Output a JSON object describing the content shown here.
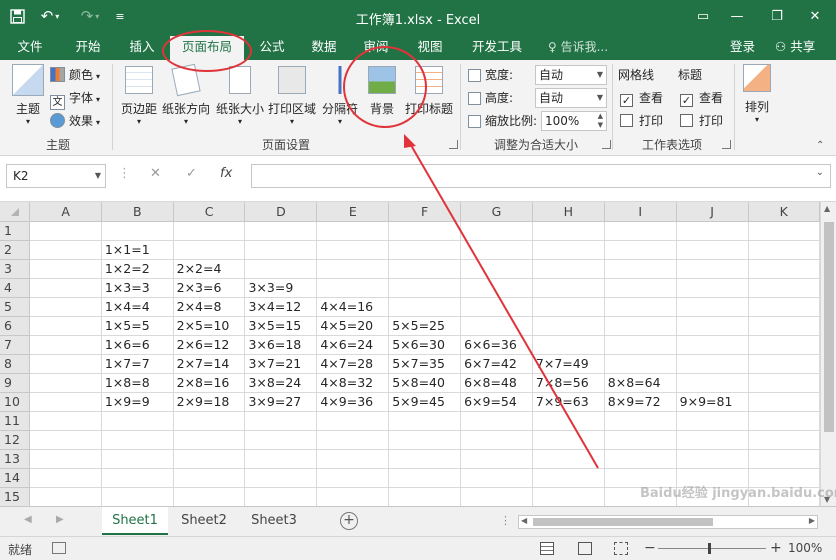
{
  "titlebar": {
    "save_icon": "save-icon",
    "undo_icon": "undo-icon",
    "redo_icon": "redo-icon",
    "title": "工作簿1.xlsx - Excel",
    "min": "—",
    "restore": "❐",
    "close": "✕",
    "ribbon_display": "▭"
  },
  "tabs": [
    "文件",
    "开始",
    "插入",
    "页面布局",
    "公式",
    "数据",
    "审阅",
    "视图",
    "开发工具"
  ],
  "active_tab": "页面布局",
  "tellme": "告诉我...",
  "login": "登录",
  "share": "共享",
  "ribbon": {
    "theme_group": {
      "label": "主题",
      "theme": "主题",
      "colors": "颜色",
      "fonts": "字体",
      "effects": "效果"
    },
    "page_setup": {
      "label": "页面设置",
      "margins": "页边距",
      "orientation": "纸张方向",
      "size": "纸张大小",
      "print_area": "打印区域",
      "breaks": "分隔符",
      "background": "背景",
      "print_titles": "打印标题"
    },
    "scale_group": {
      "label": "调整为合适大小",
      "width_label": "宽度:",
      "width_value": "自动",
      "height_label": "高度:",
      "height_value": "自动",
      "scale_label": "缩放比例:",
      "scale_value": "100%"
    },
    "sheet_options": {
      "label": "工作表选项",
      "gridlines": "网格线",
      "headings": "标题",
      "view": "查看",
      "print": "打印"
    },
    "arrange": {
      "label": "排列"
    }
  },
  "formula_bar": {
    "name_box": "K2",
    "cancel": "✕",
    "enter": "✓",
    "fx": "fx",
    "value": ""
  },
  "columns": [
    "A",
    "B",
    "C",
    "D",
    "E",
    "F",
    "G",
    "H",
    "I",
    "J",
    "K"
  ],
  "rows": [
    {
      "n": "1",
      "cells": [
        "",
        "",
        "",
        "",
        "",
        "",
        "",
        "",
        "",
        "",
        ""
      ]
    },
    {
      "n": "2",
      "cells": [
        "",
        "1×1=1",
        "",
        "",
        "",
        "",
        "",
        "",
        "",
        "",
        ""
      ]
    },
    {
      "n": "3",
      "cells": [
        "",
        "1×2=2",
        "2×2=4",
        "",
        "",
        "",
        "",
        "",
        "",
        "",
        ""
      ]
    },
    {
      "n": "4",
      "cells": [
        "",
        "1×3=3",
        "2×3=6",
        "3×3=9",
        "",
        "",
        "",
        "",
        "",
        "",
        ""
      ]
    },
    {
      "n": "5",
      "cells": [
        "",
        "1×4=4",
        "2×4=8",
        "3×4=12",
        "4×4=16",
        "",
        "",
        "",
        "",
        "",
        ""
      ]
    },
    {
      "n": "6",
      "cells": [
        "",
        "1×5=5",
        "2×5=10",
        "3×5=15",
        "4×5=20",
        "5×5=25",
        "",
        "",
        "",
        "",
        ""
      ]
    },
    {
      "n": "7",
      "cells": [
        "",
        "1×6=6",
        "2×6=12",
        "3×6=18",
        "4×6=24",
        "5×6=30",
        "6×6=36",
        "",
        "",
        "",
        ""
      ]
    },
    {
      "n": "8",
      "cells": [
        "",
        "1×7=7",
        "2×7=14",
        "3×7=21",
        "4×7=28",
        "5×7=35",
        "6×7=42",
        "7×7=49",
        "",
        "",
        ""
      ]
    },
    {
      "n": "9",
      "cells": [
        "",
        "1×8=8",
        "2×8=16",
        "3×8=24",
        "4×8=32",
        "5×8=40",
        "6×8=48",
        "7×8=56",
        "8×8=64",
        "",
        ""
      ]
    },
    {
      "n": "10",
      "cells": [
        "",
        "1×9=9",
        "2×9=18",
        "3×9=27",
        "4×9=36",
        "5×9=45",
        "6×9=54",
        "7×9=63",
        "8×9=72",
        "9×9=81",
        ""
      ]
    },
    {
      "n": "11",
      "cells": [
        "",
        "",
        "",
        "",
        "",
        "",
        "",
        "",
        "",
        "",
        ""
      ]
    },
    {
      "n": "12",
      "cells": [
        "",
        "",
        "",
        "",
        "",
        "",
        "",
        "",
        "",
        "",
        ""
      ]
    },
    {
      "n": "13",
      "cells": [
        "",
        "",
        "",
        "",
        "",
        "",
        "",
        "",
        "",
        "",
        ""
      ]
    },
    {
      "n": "14",
      "cells": [
        "",
        "",
        "",
        "",
        "",
        "",
        "",
        "",
        "",
        "",
        ""
      ]
    },
    {
      "n": "15",
      "cells": [
        "",
        "",
        "",
        "",
        "",
        "",
        "",
        "",
        "",
        "",
        ""
      ]
    }
  ],
  "sheets": [
    "Sheet1",
    "Sheet2",
    "Sheet3"
  ],
  "active_sheet": "Sheet1",
  "status": {
    "ready": "就绪",
    "zoom": "100%",
    "zoom_minus": "−",
    "zoom_plus": "+"
  },
  "watermark": "Baidu经验 jingyan.baidu.com",
  "colors": {
    "excel_green": "#217346",
    "annotation_red": "#e0343a"
  }
}
